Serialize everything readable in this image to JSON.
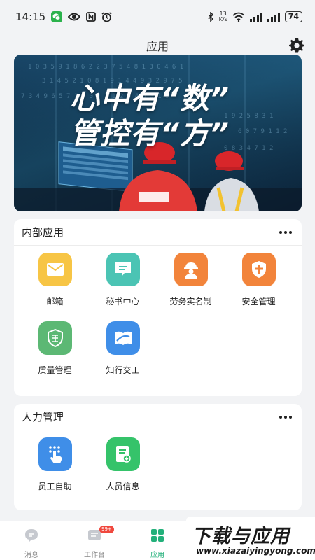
{
  "status_bar": {
    "time": "14:15",
    "net_speed_value": "13",
    "net_speed_unit": "K/s",
    "battery": "74",
    "left_icons": [
      "wechat-icon",
      "eye-icon",
      "nfc-icon",
      "alarm-icon"
    ],
    "right_icons": [
      "bluetooth-icon",
      "wifi-icon",
      "signal-icon",
      "signal-icon"
    ]
  },
  "header": {
    "title": "应用"
  },
  "banner": {
    "line1": "心中有“数”",
    "line2": "管控有“方”"
  },
  "internal_apps": {
    "title": "内部应用",
    "items": [
      {
        "label": "邮箱",
        "icon": "mail-icon",
        "color": "#f7c545"
      },
      {
        "label": "秘书中心",
        "icon": "message-icon",
        "color": "#4bc4b4"
      },
      {
        "label": "劳务实名制",
        "icon": "worker-icon",
        "color": "#f2843b"
      },
      {
        "label": "安全管理",
        "icon": "shield-icon",
        "color": "#f2843b"
      },
      {
        "label": "质量管理",
        "icon": "quality-shield-icon",
        "color": "#5cb874"
      },
      {
        "label": "知行交工",
        "icon": "book-icon",
        "color": "#3f8ee8"
      }
    ]
  },
  "hr": {
    "title": "人力管理",
    "items": [
      {
        "label": "员工自助",
        "icon": "hand-tap-icon",
        "color": "#3f8ee8"
      },
      {
        "label": "人员信息",
        "icon": "document-icon",
        "color": "#35c36a"
      }
    ]
  },
  "tabbar": {
    "tabs": [
      {
        "label": "消息",
        "icon": "chat-icon",
        "active": false
      },
      {
        "label": "工作台",
        "icon": "workbench-icon",
        "active": false,
        "badge": "99+"
      },
      {
        "label": "应用",
        "icon": "apps-grid-icon",
        "active": true
      }
    ]
  },
  "watermark": {
    "big": "下载与应用",
    "small": "www.xiazaiyingyong.com"
  },
  "colors": {
    "accent": "#22b07a",
    "badge": "#f0483e",
    "background": "#f2f3f5"
  }
}
